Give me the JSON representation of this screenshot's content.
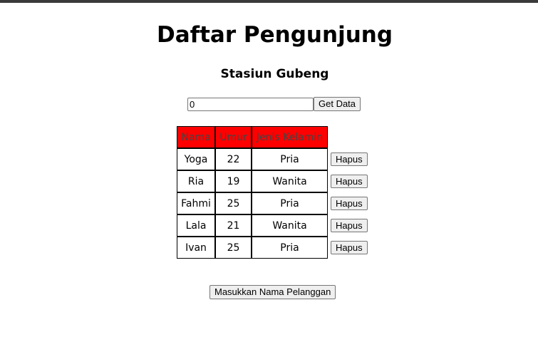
{
  "header": {
    "title": "Daftar Pengunjung",
    "subtitle": "Stasiun Gubeng"
  },
  "form": {
    "input_value": "0",
    "get_button_label": "Get Data"
  },
  "table": {
    "header_color": "#ff0000",
    "columns": [
      "Nama",
      "Umur",
      "Jenis Kelamin"
    ],
    "rows": [
      {
        "nama": "Yoga",
        "umur": "22",
        "jenis_kelamin": "Pria"
      },
      {
        "nama": "Ria",
        "umur": "19",
        "jenis_kelamin": "Wanita"
      },
      {
        "nama": "Fahmi",
        "umur": "25",
        "jenis_kelamin": "Pria"
      },
      {
        "nama": "Lala",
        "umur": "21",
        "jenis_kelamin": "Wanita"
      },
      {
        "nama": "Ivan",
        "umur": "25",
        "jenis_kelamin": "Pria"
      }
    ],
    "delete_label": "Hapus"
  },
  "footer": {
    "add_button_label": "Masukkan Nama Pelanggan"
  }
}
